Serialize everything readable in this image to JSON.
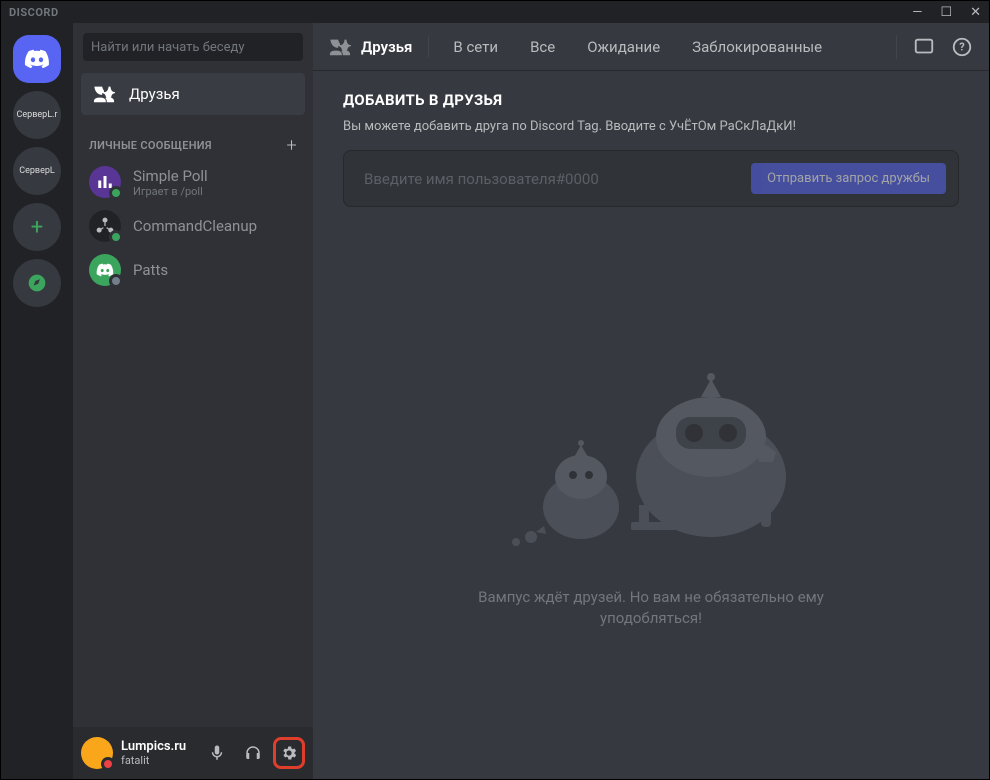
{
  "titlebar": {
    "logo": "DISCORD"
  },
  "guilds": {
    "server1": "СерверL.r",
    "server2": "СерверL"
  },
  "channels": {
    "search_placeholder": "Найти или начать беседу",
    "friends_label": "Друзья",
    "dm_header": "ЛИЧНЫЕ СООБЩЕНИЯ",
    "dms": [
      {
        "name": "Simple Poll",
        "activity": "Играет в /poll"
      },
      {
        "name": "CommandCleanup",
        "activity": ""
      },
      {
        "name": "Patts",
        "activity": ""
      }
    ]
  },
  "user": {
    "name": "Lumpics.ru",
    "tag": "fatalit"
  },
  "topbar": {
    "friends": "Друзья",
    "tabs": {
      "online": "В сети",
      "all": "Все",
      "pending": "Ожидание",
      "blocked": "Заблокированные"
    }
  },
  "content": {
    "title": "ДОБАВИТЬ В ДРУЗЬЯ",
    "subtitle": "Вы можете добавить друга по Discord Tag. Вводите с УчЁтОм РаСкЛаДкИ!",
    "input_placeholder": "Введите имя пользователя#0000",
    "send_button": "Отправить запрос дружбы",
    "wumpus_text": "Вампус ждёт друзей. Но вам не обязательно ему уподобляться!"
  }
}
